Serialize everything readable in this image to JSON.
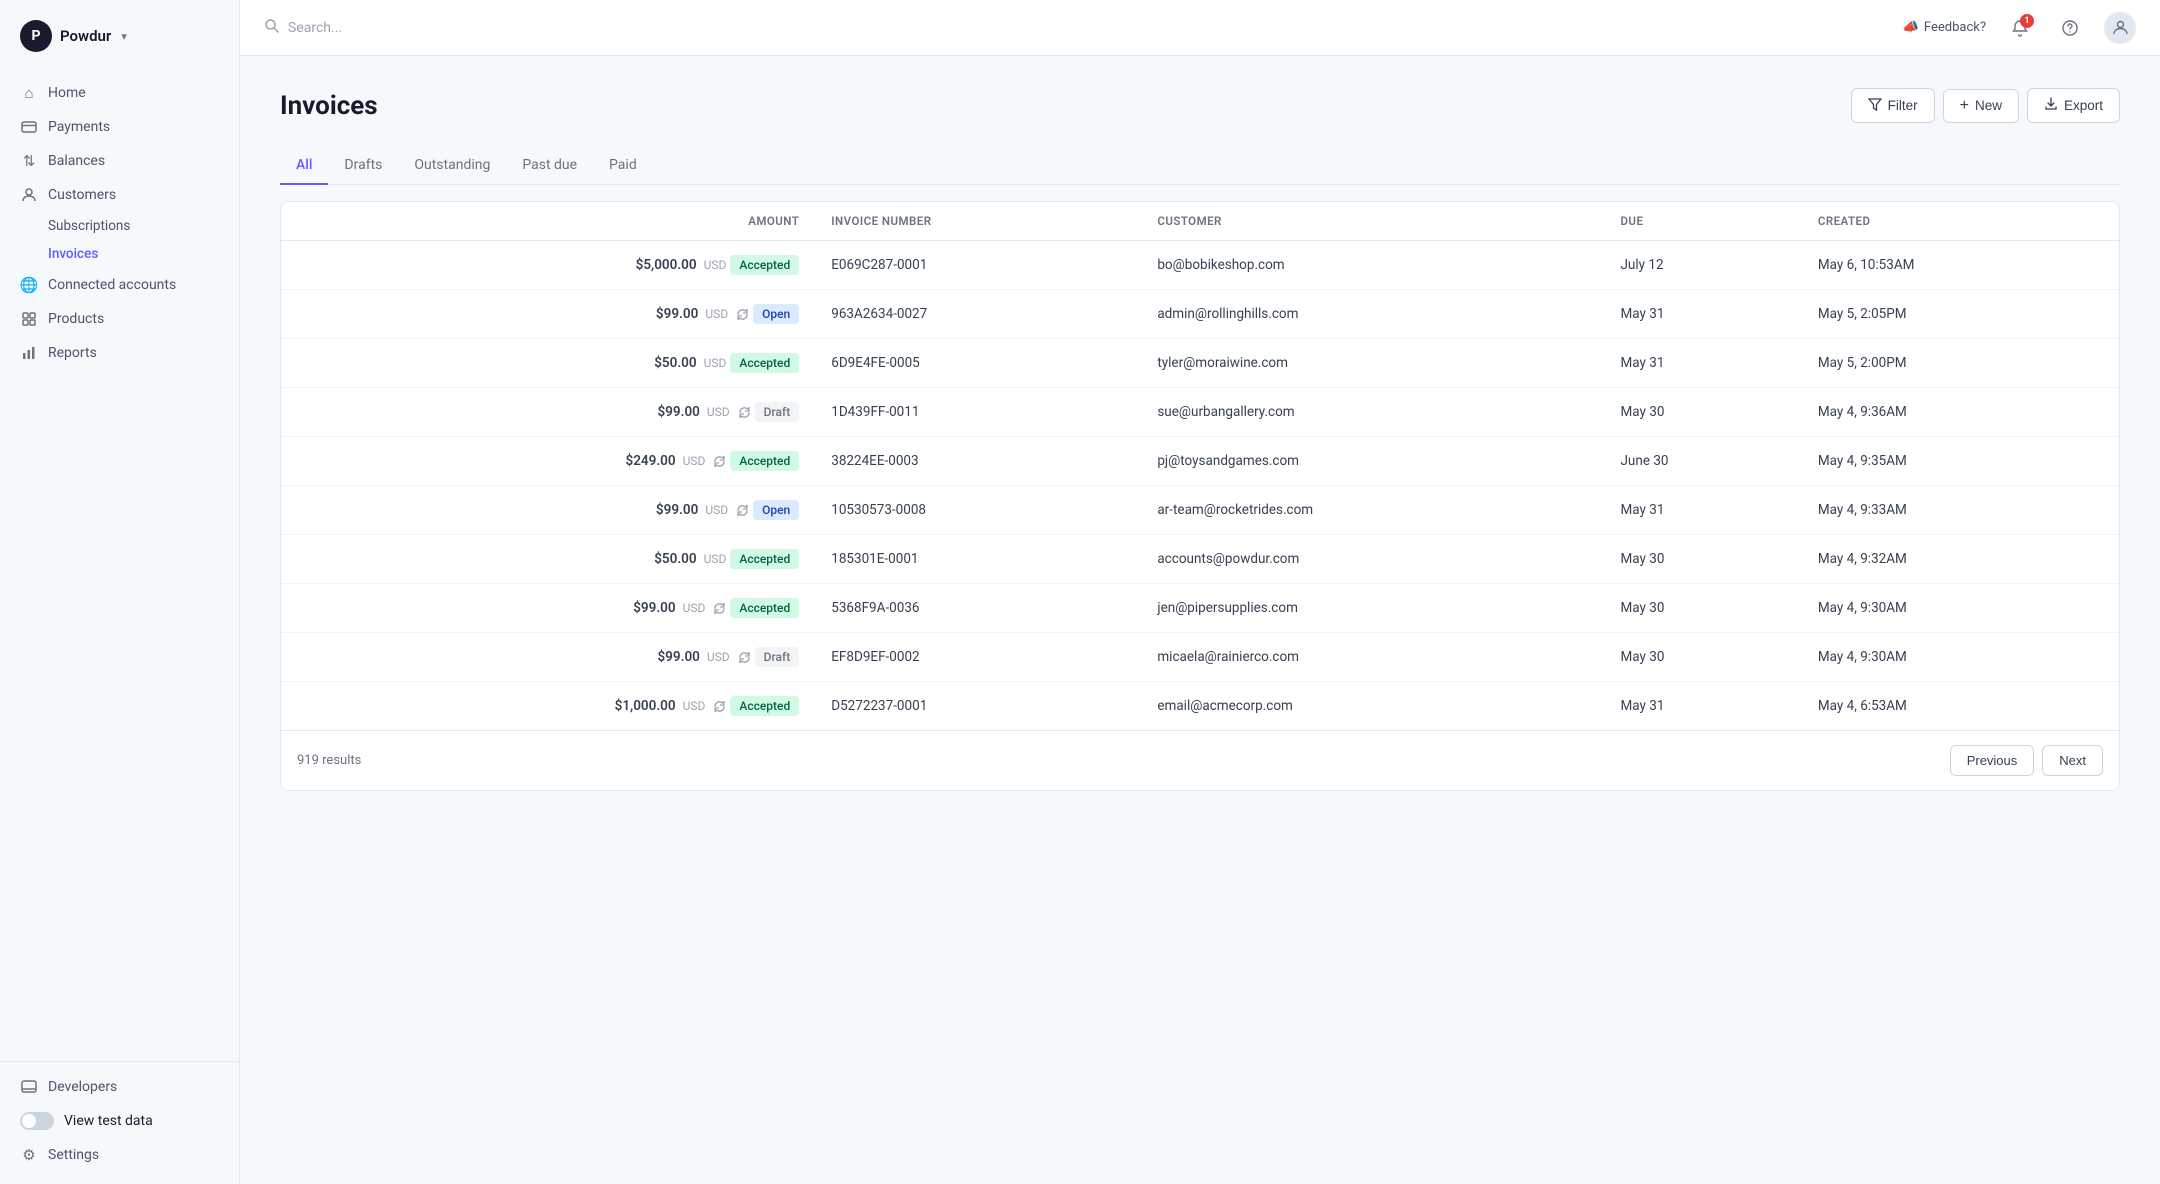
{
  "app": {
    "company": "Powdur",
    "logo_letter": "P"
  },
  "sidebar": {
    "nav_items": [
      {
        "id": "home",
        "label": "Home",
        "icon": "🏠"
      },
      {
        "id": "payments",
        "label": "Payments",
        "icon": "💳"
      },
      {
        "id": "balances",
        "label": "Balances",
        "icon": "⇅"
      },
      {
        "id": "customers",
        "label": "Customers",
        "icon": "●"
      }
    ],
    "sub_items": [
      {
        "id": "subscriptions",
        "label": "Subscriptions"
      },
      {
        "id": "invoices",
        "label": "Invoices",
        "active": true
      }
    ],
    "lower_items": [
      {
        "id": "connected-accounts",
        "label": "Connected accounts",
        "icon": "🌐"
      },
      {
        "id": "products",
        "label": "Products",
        "icon": "📦"
      },
      {
        "id": "reports",
        "label": "Reports",
        "icon": "📊"
      }
    ],
    "bottom_items": [
      {
        "id": "developers",
        "label": "Developers",
        "icon": "🖥"
      },
      {
        "id": "settings",
        "label": "Settings",
        "icon": "⚙"
      }
    ],
    "toggle_label": "View test data"
  },
  "topbar": {
    "search_placeholder": "Search...",
    "feedback_label": "Feedback?",
    "notification_count": "1"
  },
  "page": {
    "title": "Invoices",
    "filter_btn": "Filter",
    "new_btn": "New",
    "export_btn": "Export"
  },
  "tabs": [
    {
      "id": "all",
      "label": "All",
      "active": true
    },
    {
      "id": "drafts",
      "label": "Drafts"
    },
    {
      "id": "outstanding",
      "label": "Outstanding"
    },
    {
      "id": "past-due",
      "label": "Past due"
    },
    {
      "id": "paid",
      "label": "Paid"
    }
  ],
  "table": {
    "columns": [
      {
        "id": "amount",
        "label": "AMOUNT"
      },
      {
        "id": "invoice_number",
        "label": "INVOICE NUMBER"
      },
      {
        "id": "customer",
        "label": "CUSTOMER"
      },
      {
        "id": "due",
        "label": "DUE"
      },
      {
        "id": "created",
        "label": "CREATED"
      }
    ],
    "rows": [
      {
        "amount": "$5,000.00",
        "currency": "USD",
        "recurring": false,
        "status": "Accepted",
        "status_type": "accepted",
        "invoice_number": "E069C287-0001",
        "customer": "bo@bobikeshop.com",
        "due": "July 12",
        "created": "May 6, 10:53AM"
      },
      {
        "amount": "$99.00",
        "currency": "USD",
        "recurring": true,
        "status": "Open",
        "status_type": "open",
        "invoice_number": "963A2634-0027",
        "customer": "admin@rollinghills.com",
        "due": "May 31",
        "created": "May 5, 2:05PM"
      },
      {
        "amount": "$50.00",
        "currency": "USD",
        "recurring": false,
        "status": "Accepted",
        "status_type": "accepted",
        "invoice_number": "6D9E4FE-0005",
        "customer": "tyler@moraiwine.com",
        "due": "May 31",
        "created": "May 5, 2:00PM"
      },
      {
        "amount": "$99.00",
        "currency": "USD",
        "recurring": true,
        "status": "Draft",
        "status_type": "draft",
        "invoice_number": "1D439FF-0011",
        "customer": "sue@urbangallery.com",
        "due": "May 30",
        "created": "May 4, 9:36AM"
      },
      {
        "amount": "$249.00",
        "currency": "USD",
        "recurring": true,
        "status": "Accepted",
        "status_type": "accepted",
        "invoice_number": "38224EE-0003",
        "customer": "pj@toysandgames.com",
        "due": "June 30",
        "created": "May 4, 9:35AM"
      },
      {
        "amount": "$99.00",
        "currency": "USD",
        "recurring": true,
        "status": "Open",
        "status_type": "open",
        "invoice_number": "10530573-0008",
        "customer": "ar-team@rocketrides.com",
        "due": "May 31",
        "created": "May 4, 9:33AM"
      },
      {
        "amount": "$50.00",
        "currency": "USD",
        "recurring": false,
        "status": "Accepted",
        "status_type": "accepted",
        "invoice_number": "185301E-0001",
        "customer": "accounts@powdur.com",
        "due": "May 30",
        "created": "May 4, 9:32AM"
      },
      {
        "amount": "$99.00",
        "currency": "USD",
        "recurring": true,
        "status": "Accepted",
        "status_type": "accepted",
        "invoice_number": "5368F9A-0036",
        "customer": "jen@pipersupplies.com",
        "due": "May 30",
        "created": "May 4, 9:30AM"
      },
      {
        "amount": "$99.00",
        "currency": "USD",
        "recurring": true,
        "status": "Draft",
        "status_type": "draft",
        "invoice_number": "EF8D9EF-0002",
        "customer": "micaela@rainierco.com",
        "due": "May 30",
        "created": "May 4, 9:30AM"
      },
      {
        "amount": "$1,000.00",
        "currency": "USD",
        "recurring": true,
        "status": "Accepted",
        "status_type": "accepted",
        "invoice_number": "D5272237-0001",
        "customer": "email@acmecorp.com",
        "due": "May 31",
        "created": "May 4, 6:53AM"
      }
    ]
  },
  "footer": {
    "results_count": "919 results",
    "previous_btn": "Previous",
    "next_btn": "Next"
  }
}
